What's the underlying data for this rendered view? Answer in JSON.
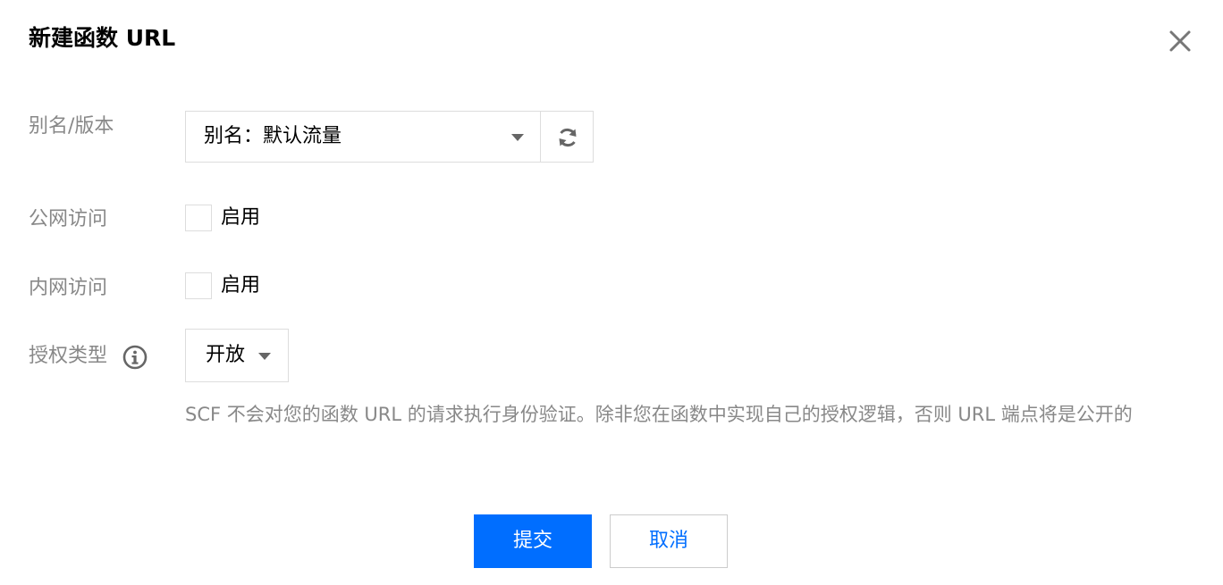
{
  "dialog": {
    "title": "新建函数 URL",
    "close_icon": "close-icon"
  },
  "form": {
    "alias_version": {
      "label": "别名/版本",
      "selected": "别名：默认流量",
      "refresh_icon": "refresh-icon"
    },
    "public_access": {
      "label": "公网访问",
      "checkbox_label": "启用",
      "checked": false
    },
    "private_access": {
      "label": "内网访问",
      "checkbox_label": "启用",
      "checked": false
    },
    "auth_type": {
      "label": "授权类型",
      "info_icon": "info-icon",
      "selected": "开放",
      "hint": "SCF 不会对您的函数 URL 的请求执行身份验证。除非您在函数中实现自己的授权逻辑，否则 URL 端点将是公开的"
    }
  },
  "footer": {
    "submit_label": "提交",
    "cancel_label": "取消"
  },
  "colors": {
    "primary": "#006eff",
    "label": "#888888",
    "border": "#dddddd"
  }
}
